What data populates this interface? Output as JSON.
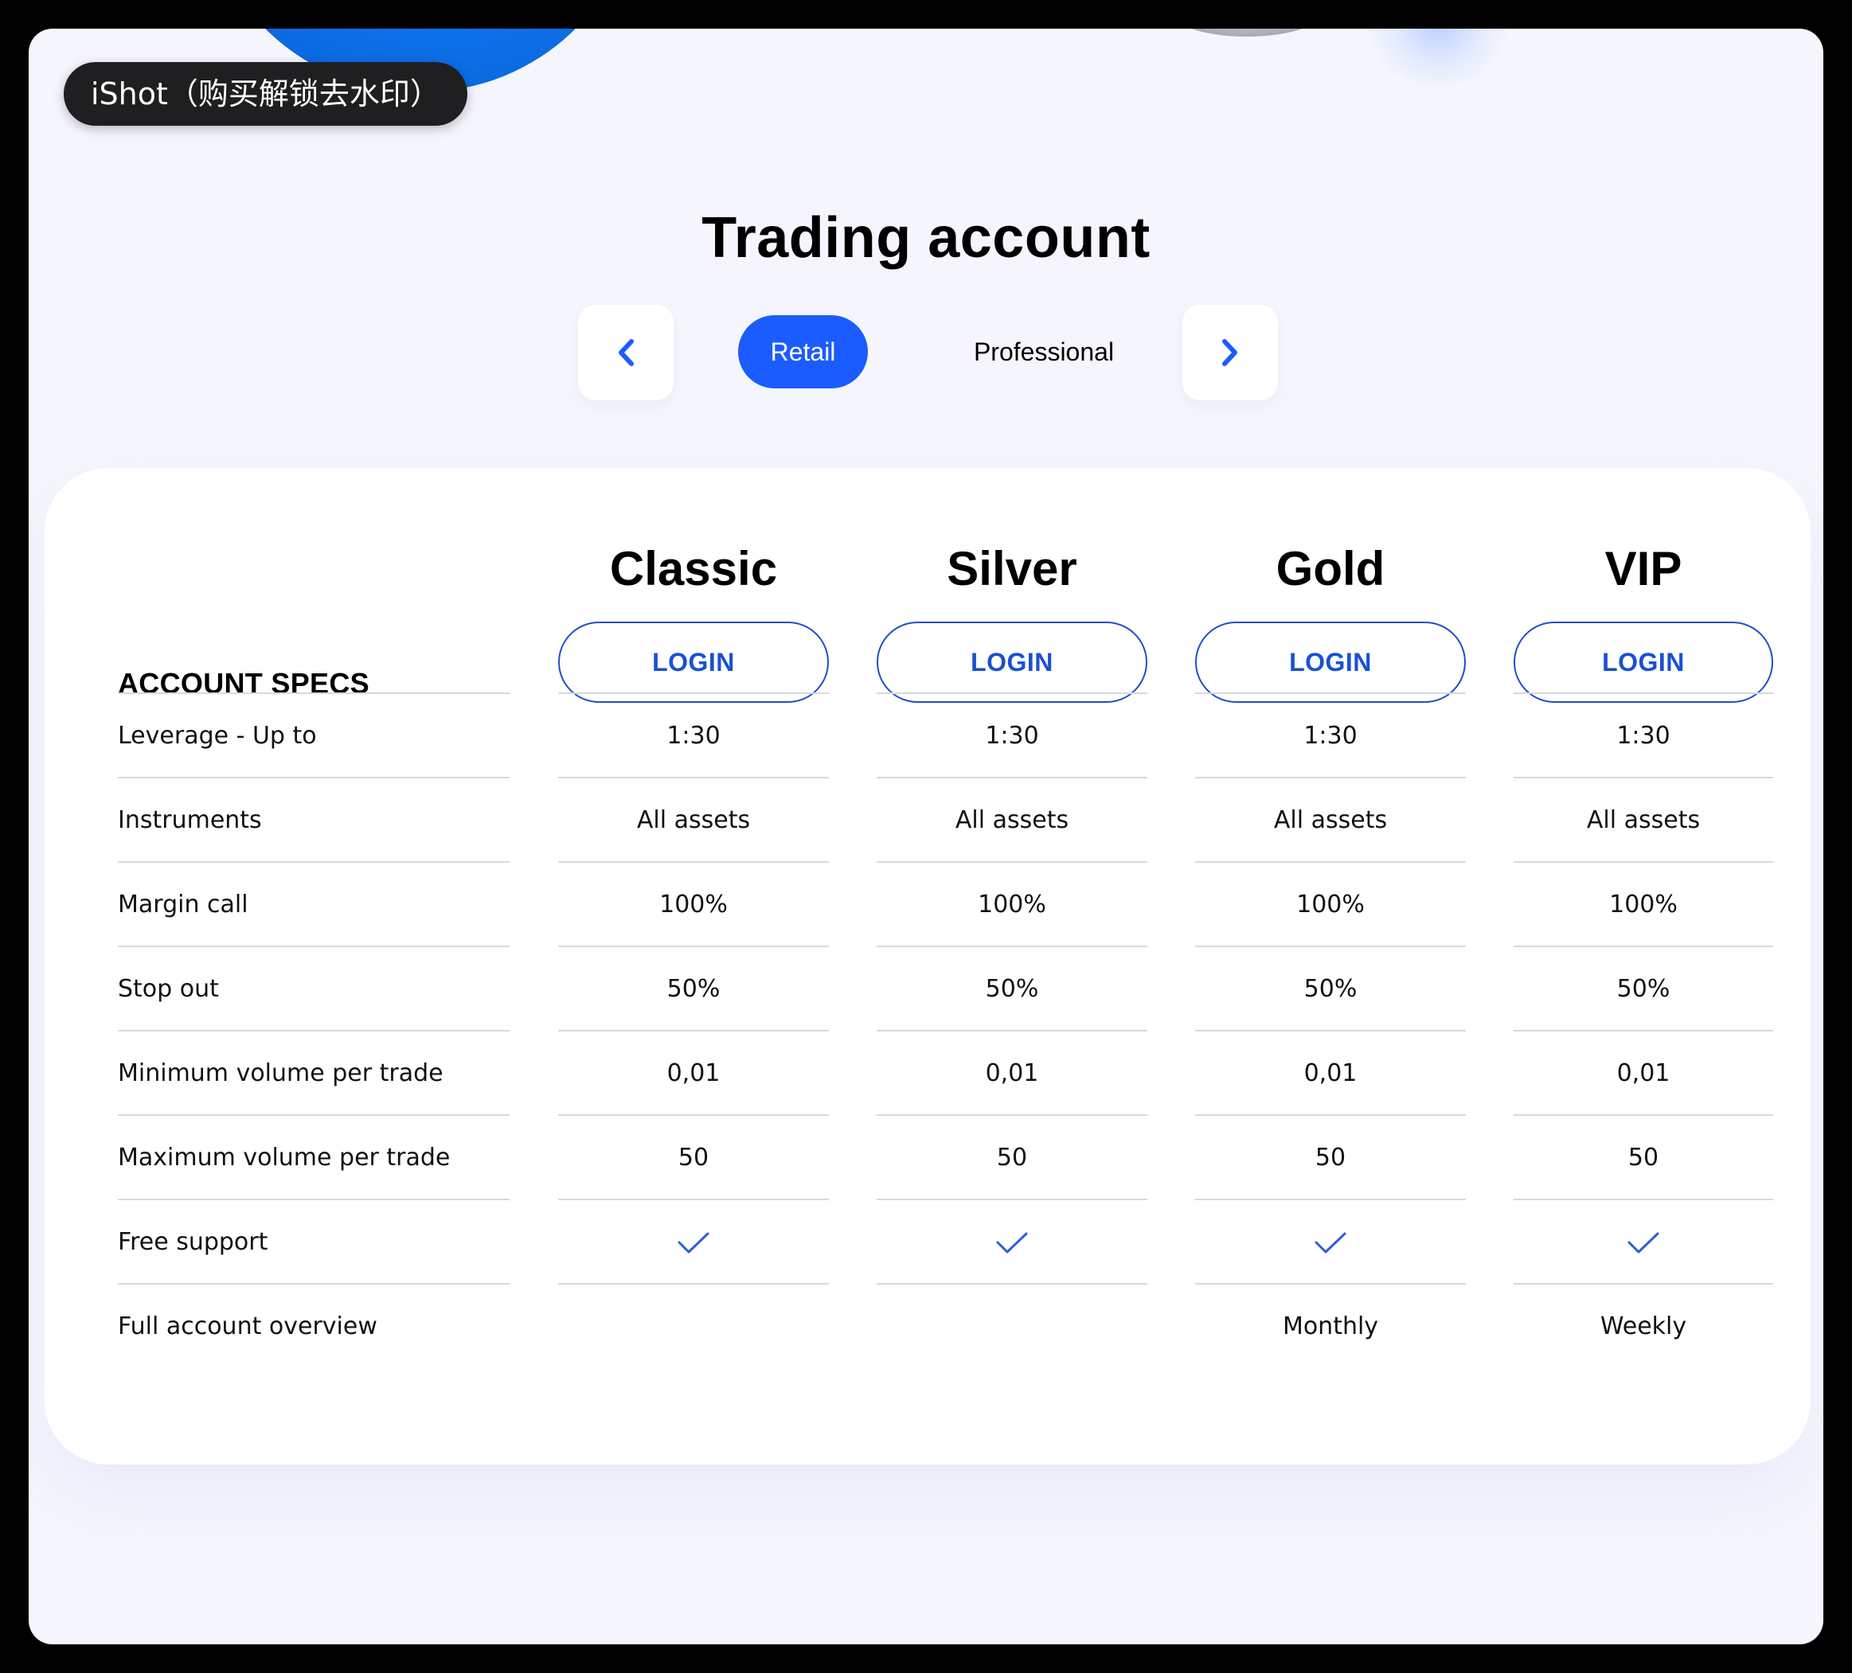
{
  "watermark": "iShot（购买解锁去水印）",
  "title": "Trading account",
  "nav": {
    "prev_icon": "chevron-left-icon",
    "next_icon": "chevron-right-icon",
    "tabs": [
      {
        "label": "Retail",
        "active": true
      },
      {
        "label": "Professional",
        "active": false
      }
    ]
  },
  "table": {
    "specs_heading": "ACCOUNT SPECS",
    "columns": [
      {
        "name": "Classic",
        "button": "LOGIN"
      },
      {
        "name": "Silver",
        "button": "LOGIN"
      },
      {
        "name": "Gold",
        "button": "LOGIN"
      },
      {
        "name": "VIP",
        "button": "LOGIN"
      }
    ],
    "rows": [
      {
        "label": "Leverage - Up to",
        "values": [
          "1:30",
          "1:30",
          "1:30",
          "1:30"
        ]
      },
      {
        "label": "Instruments",
        "values": [
          "All assets",
          "All assets",
          "All assets",
          "All assets"
        ]
      },
      {
        "label": "Margin call",
        "values": [
          "100%",
          "100%",
          "100%",
          "100%"
        ]
      },
      {
        "label": "Stop out",
        "values": [
          "50%",
          "50%",
          "50%",
          "50%"
        ]
      },
      {
        "label": "Minimum volume per trade",
        "values": [
          "0,01",
          "0,01",
          "0,01",
          "0,01"
        ]
      },
      {
        "label": "Maximum volume per trade",
        "values": [
          "50",
          "50",
          "50",
          "50"
        ]
      },
      {
        "label": "Free support",
        "values": [
          "check-icon",
          "check-icon",
          "check-icon",
          "check-icon"
        ]
      },
      {
        "label": "Full account overview",
        "values": [
          "",
          "",
          "Monthly",
          "Weekly"
        ]
      }
    ]
  },
  "colors": {
    "accent": "#1a5cff",
    "button_text": "#1a50d6",
    "page_background": "#f5f6fd",
    "card_background": "#ffffff"
  }
}
